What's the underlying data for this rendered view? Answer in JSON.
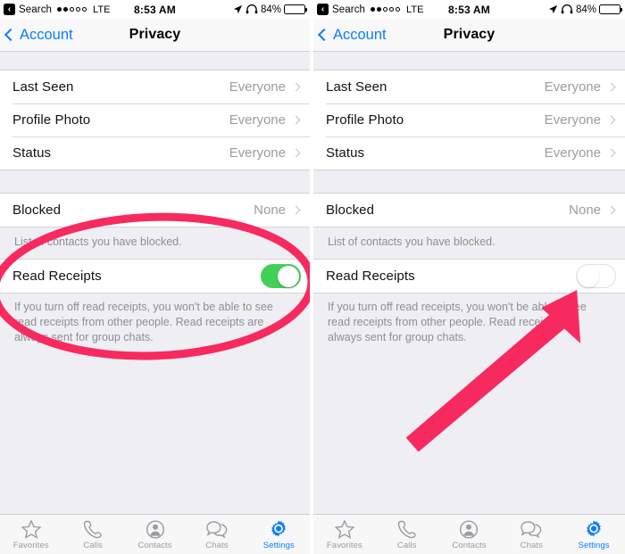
{
  "meta": {
    "app": "WhatsApp",
    "screen": "Privacy settings — before and after toggling Read Receipts",
    "accent_blue": "#0a7cff",
    "toggle_on_green": "#43d058",
    "annotation_pink": "#f72a60",
    "background_gray": "#efeef3"
  },
  "status_bar": {
    "back_glyph": "‹",
    "carrier": "Search",
    "signal_dots_filled": 2,
    "signal_dots_empty": 3,
    "network": "LTE",
    "time": "8:53 AM",
    "location_icon": "location-arrow-icon",
    "headphones_icon": "headphones-icon",
    "battery_percent": "84%",
    "battery_level": 84
  },
  "nav_bar": {
    "back_label": "Account",
    "back_icon": "chevron-left-icon",
    "title": "Privacy"
  },
  "privacy_rows": [
    {
      "label": "Last Seen",
      "value": "Everyone",
      "accessory": "chevron-right-icon"
    },
    {
      "label": "Profile Photo",
      "value": "Everyone",
      "accessory": "chevron-right-icon"
    },
    {
      "label": "Status",
      "value": "Everyone",
      "accessory": "chevron-right-icon"
    }
  ],
  "blocked_row": {
    "label": "Blocked",
    "value": "None",
    "accessory": "chevron-right-icon",
    "caption": "List of contacts you have blocked."
  },
  "read_receipts": {
    "label": "Read Receipts",
    "caption": "If you turn off read receipts, you won't be able to see read receipts from other people. Read receipts are always sent for group chats.",
    "left_panel_state": "on",
    "right_panel_state": "off"
  },
  "tab_bar": [
    {
      "label": "Favorites",
      "icon": "star-icon",
      "active": false
    },
    {
      "label": "Calls",
      "icon": "phone-icon",
      "active": false
    },
    {
      "label": "Contacts",
      "icon": "person-circle-icon",
      "active": false
    },
    {
      "label": "Chats",
      "icon": "speech-bubbles-icon",
      "active": false
    },
    {
      "label": "Settings",
      "icon": "gear-icon",
      "active": true
    }
  ],
  "annotations": {
    "ellipse": {
      "shape": "ellipse-highlight",
      "target": "read-receipts-row-left",
      "color": "#f72a60"
    },
    "arrow": {
      "shape": "arrow-pointer",
      "target": "read-receipts-toggle-right",
      "color": "#f72a60"
    }
  }
}
